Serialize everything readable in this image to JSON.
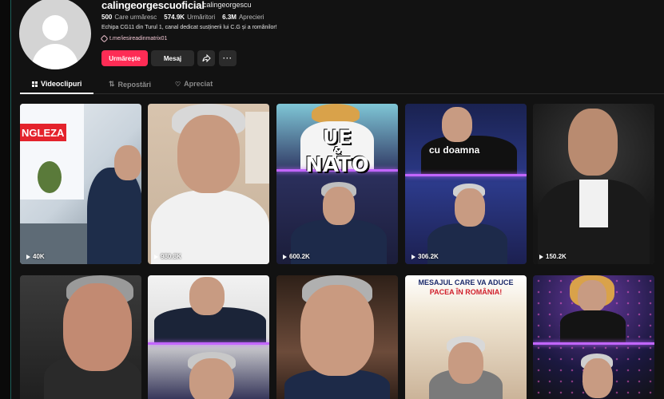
{
  "profile": {
    "username": "calingeorgescuoficial",
    "nickname": "calingeorgescu",
    "stats": [
      {
        "value": "500",
        "label": "Care urmăresc"
      },
      {
        "value": "574.9K",
        "label": "Urmăritori"
      },
      {
        "value": "6.3M",
        "label": "Aprecieri"
      }
    ],
    "bio": "Echipa CG11 din Turul 1, canal dedicat susținerii lui C.G și a românilor!",
    "link": "t.me/iesireadinmatrix01"
  },
  "actions": {
    "follow_label": "Urmărește",
    "message_label": "Mesaj",
    "share_icon": "share-icon",
    "more_label": "···"
  },
  "tabs": [
    {
      "label": "Videoclipuri",
      "icon": "grid-icon",
      "active": true
    },
    {
      "label": "Repostări",
      "icon": "repost-icon",
      "active": false
    },
    {
      "label": "Apreciat",
      "icon": "heart-outline-icon",
      "active": false
    }
  ],
  "videos": [
    {
      "views": "40K",
      "overlay": "NGLEZA"
    },
    {
      "views": "980.8K",
      "overlay": ""
    },
    {
      "views": "600.2K",
      "overlay_line1": "UE",
      "overlay_line2": "&",
      "overlay_line3": "NATO"
    },
    {
      "views": "306.2K",
      "overlay": "cu doamna"
    },
    {
      "views": "150.2K",
      "overlay": ""
    },
    {
      "views": "",
      "overlay": ""
    },
    {
      "views": "",
      "overlay": ""
    },
    {
      "views": "",
      "overlay": ""
    },
    {
      "views": "",
      "overlay_line1": "MESAJUL CARE VA ADUCE",
      "overlay_line2": "PACEA ÎN ROMÂNIA!"
    },
    {
      "views": "",
      "overlay": ""
    }
  ],
  "colors": {
    "accent": "#fe2c55",
    "background": "#121212",
    "divider_glow": "#c266ff"
  }
}
